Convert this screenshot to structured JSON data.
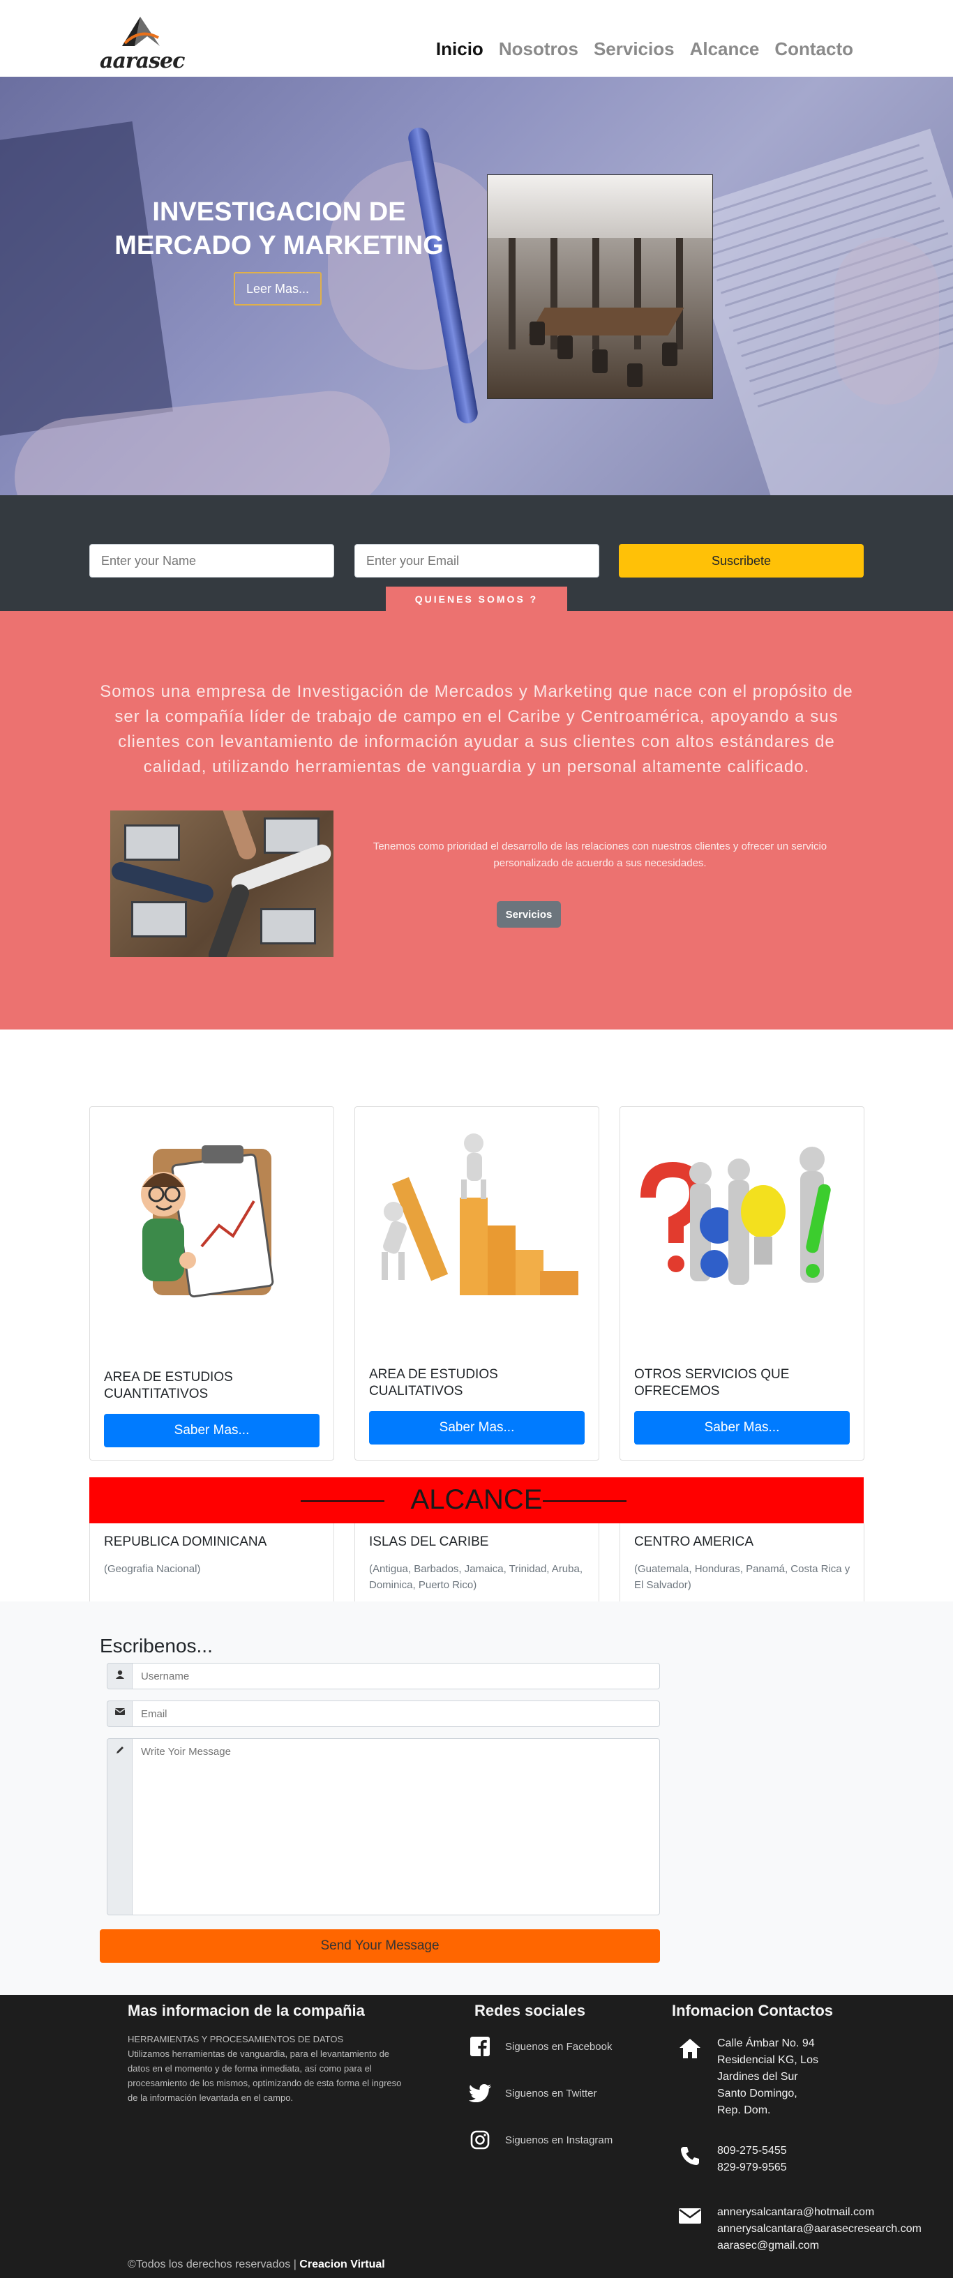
{
  "nav": {
    "logo_text": "aarasec",
    "items": [
      {
        "label": "Inicio"
      },
      {
        "label": "Nosotros"
      },
      {
        "label": "Servicios"
      },
      {
        "label": "Alcance"
      },
      {
        "label": "Contacto"
      }
    ]
  },
  "hero": {
    "title_line1": "INVESTIGACION DE",
    "title_line2": "MERCADO Y MARKETING",
    "button_label": "Leer Mas..."
  },
  "subscribe": {
    "name_placeholder": "Enter your Name",
    "email_placeholder": "Enter your Email",
    "button_label": "Suscribete",
    "about_tab_label": "QUIENES SOMOS ?"
  },
  "about": {
    "text": "Somos una empresa de Investigación de Mercados y Marketing que nace con el propósito de ser la compañía líder de trabajo de campo en el Caribe y Centroamérica, apoyando a sus clientes con levantamiento de información ayudar a sus clientes con altos estándares de calidad, utilizando herramientas de vanguardia y un personal altamente calificado.",
    "side_text": "Tenemos como prioridad el desarrollo de las relaciones con nuestros clientes y ofrecer un servicio personalizado de acuerdo a sus necesidades.",
    "button_label": "Servicios"
  },
  "services": {
    "cards": [
      {
        "title": "AREA DE ESTUDIOS CUANTITATIVOS",
        "button_label": "Saber Mas..."
      },
      {
        "title": "AREA DE ESTUDIOS CUALITATIVOS",
        "button_label": "Saber Mas..."
      },
      {
        "title": "OTROS SERVICIOS QUE OFRECEMOS",
        "button_label": "Saber Mas..."
      }
    ]
  },
  "alcance": {
    "banner_label": "ALCANCE",
    "regions": [
      {
        "title": "REPUBLICA DOMINICANA",
        "detail": "(Geografia Nacional)"
      },
      {
        "title": "ISLAS DEL CARIBE",
        "detail": "(Antigua, Barbados, Jamaica, Trinidad, Aruba, Dominica, Puerto Rico)"
      },
      {
        "title": "CENTRO AMERICA",
        "detail": "(Guatemala, Honduras, Panamá, Costa Rica y El Salvador)"
      }
    ]
  },
  "contact": {
    "heading": "Escribenos...",
    "username_placeholder": "Username",
    "email_placeholder": "Email",
    "message_placeholder": "Write Yoir Message",
    "send_label": "Send Your Message"
  },
  "footer": {
    "company_heading": "Mas informacion de la compañia",
    "company_sub": "HERRAMIENTAS Y PROCESAMIENTOS DE DATOS",
    "company_body": "Utilizamos herramientas de vanguardia, para el levantamiento de datos en el momento y de forma inmediata, así como para el procesamiento de los mismos, optimizando de esta forma el ingreso de la información levantada en el campo.",
    "social_heading": "Redes sociales",
    "social": [
      {
        "icon": "facebook-icon",
        "label": "Siguenos en Facebook"
      },
      {
        "icon": "twitter-icon",
        "label": "Siguenos en Twitter"
      },
      {
        "icon": "instagram-icon",
        "label": "Siguenos en Instagram"
      }
    ],
    "contact_heading": "Infomacion Contactos",
    "address": [
      "Calle Ámbar No. 94",
      "Residencial KG, Los",
      "Jardines del Sur",
      "Santo Domingo,",
      "Rep. Dom."
    ],
    "phones": [
      "809-275-5455",
      "829-979-9565"
    ],
    "emails": [
      "annerysalcantara@hotmail.com",
      "annerysalcantara@aarasecresearch.com",
      "aarasec@gmail.com"
    ],
    "copyright": "©Todos los derechos reservados |",
    "credit": "Creacion Virtual"
  }
}
